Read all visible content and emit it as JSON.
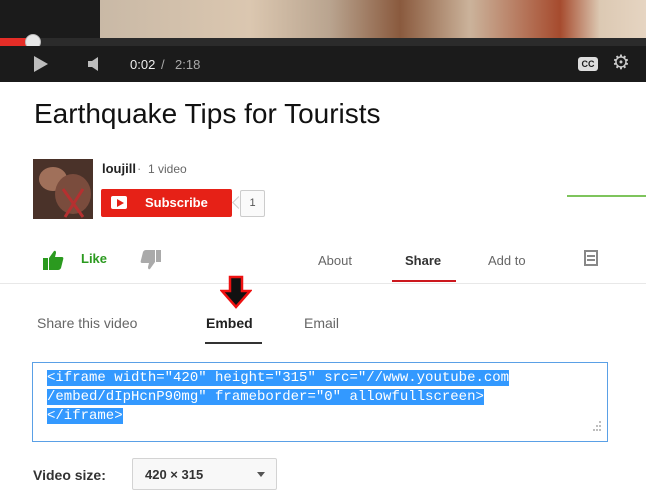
{
  "player": {
    "time_current": "0:02",
    "time_separator": "/",
    "time_total": "2:18",
    "progress_fraction": 0.014,
    "cc_label": "CC",
    "icons": [
      "play-icon",
      "volume-icon",
      "cc-icon",
      "settings-icon"
    ]
  },
  "video": {
    "title": "Earthquake Tips for Tourists"
  },
  "channel": {
    "name": "loujill",
    "separator": "·",
    "video_count": "1 video",
    "subscribe_label": "Subscribe",
    "subscriber_count": "1"
  },
  "actions": {
    "like_label": "Like",
    "tabs": {
      "about": "About",
      "share": "Share",
      "add_to": "Add to"
    }
  },
  "share": {
    "subtabs": {
      "share_this_video": "Share this video",
      "embed": "Embed",
      "email": "Email"
    },
    "embed_code_lines": [
      "<iframe width=\"420\" height=\"315\" src=\"//www.youtube.com",
      "/embed/dIpHcnP90mg\" frameborder=\"0\" allowfullscreen>",
      "</iframe>"
    ],
    "video_size_label": "Video size:",
    "video_size_value": "420 × 315"
  },
  "colors": {
    "subscribe_red": "#e62117",
    "progress_red": "#e52d27",
    "selection_blue": "#3399ff",
    "like_green": "#2b9a1f"
  }
}
